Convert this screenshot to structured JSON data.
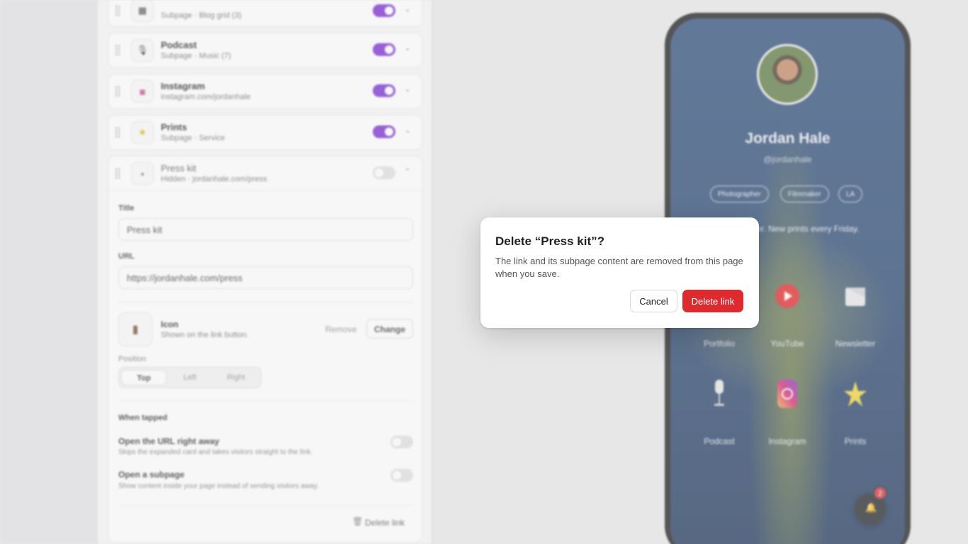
{
  "editor": {
    "links": [
      {
        "title": "",
        "subtitle": "Subpage · Blog grid (3)",
        "enabled": true,
        "icon": "grid-icon"
      },
      {
        "title": "Podcast",
        "subtitle": "Subpage · Music (7)",
        "enabled": true,
        "icon": "microphone-icon"
      },
      {
        "title": "Instagram",
        "subtitle": "instagram.com/jordanhale",
        "enabled": true,
        "icon": "instagram-icon"
      },
      {
        "title": "Prints",
        "subtitle": "Subpage · Service",
        "enabled": true,
        "icon": "star-icon"
      },
      {
        "title": "Press kit",
        "subtitle": "Hidden · jordanhale.com/press",
        "enabled": false,
        "icon": "bag-icon"
      }
    ],
    "expanded": {
      "title_label": "Title",
      "title_value": "Press kit",
      "url_label": "URL",
      "url_value": "https://jordanhale.com/press",
      "icon_title": "Icon",
      "icon_hint": "Shown on the link button.",
      "remove_label": "Remove",
      "change_label": "Change",
      "position_label": "Position",
      "positions": [
        "Top",
        "Left",
        "Right"
      ],
      "selected_position": "Top",
      "when_tapped_label": "When tapped",
      "option_url_title": "Open the URL right away",
      "option_url_sub": "Skips the expanded card and takes visitors straight to the link.",
      "option_subpage_title": "Open a subpage",
      "option_subpage_sub": "Show content inside your page instead of sending visitors away.",
      "delete_label": "Delete link"
    }
  },
  "preview": {
    "name": "Jordan Hale",
    "handle": "@jordanhale",
    "chips": [
      "Photographer",
      "Filmmaker",
      "LA"
    ],
    "bio": "t filmmaker. New prints every Friday.",
    "tiles": [
      {
        "label": "Portfolio",
        "icon": "image-icon"
      },
      {
        "label": "YouTube",
        "icon": "youtube-icon"
      },
      {
        "label": "Newsletter",
        "icon": "mail-icon"
      },
      {
        "label": "Podcast",
        "icon": "microphone-icon"
      },
      {
        "label": "Instagram",
        "icon": "instagram-icon"
      },
      {
        "label": "Prints",
        "icon": "star-icon"
      }
    ],
    "notification_count": "2"
  },
  "dialog": {
    "title": "Delete “Press kit”?",
    "body": "The link and its subpage content are removed from this page when you save.",
    "cancel_label": "Cancel",
    "confirm_label": "Delete link"
  },
  "colors": {
    "accent": "#7b2fd1",
    "danger": "#dc2a2f"
  }
}
